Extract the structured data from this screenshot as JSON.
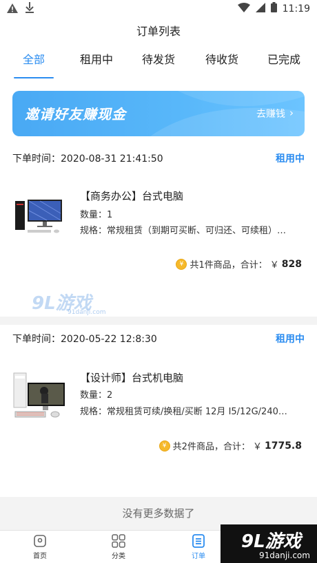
{
  "status_bar": {
    "time": "11:19",
    "left_icons": [
      "warning-icon",
      "download-icon"
    ],
    "right_icons": [
      "wifi-icon",
      "signal-icon",
      "battery-icon"
    ]
  },
  "header": {
    "title": "订单列表"
  },
  "tabs": [
    {
      "label": "全部",
      "active": true
    },
    {
      "label": "租用中",
      "active": false
    },
    {
      "label": "待发货",
      "active": false
    },
    {
      "label": "待收货",
      "active": false
    },
    {
      "label": "已完成",
      "active": false
    }
  ],
  "banner": {
    "title": "邀请好友赚现金",
    "action": "去赚钱",
    "chevron": "›"
  },
  "orders": [
    {
      "time_label": "下单时间：",
      "time": "2020-08-31 21:41:50",
      "status": "租用中",
      "product_name": "【商务办公】台式电脑",
      "qty": "数量：1",
      "spec": "规格：常规租赁（到期可买断、可归还、可续租）…",
      "count_text": "共1件商品，合计：",
      "currency": "￥",
      "amount": "828"
    },
    {
      "time_label": "下单时间：",
      "time": "2020-05-22 12:8:30",
      "status": "租用中",
      "product_name": "【设计师】台式机电脑",
      "qty": "数量：2",
      "spec": "规格：常规租赁可续/换租/买断 12月 I5/12G/240…",
      "count_text": "共2件商品，合计：",
      "currency": "￥",
      "amount": "1775.8"
    }
  ],
  "watermark": {
    "main": "9L游戏",
    "sub": "91danji.com"
  },
  "no_more_text": "没有更多数据了",
  "bottom_nav": [
    {
      "label": "首页",
      "icon": "home-icon",
      "active": false
    },
    {
      "label": "分类",
      "icon": "grid-icon",
      "active": false
    },
    {
      "label": "订单",
      "icon": "order-list-icon",
      "active": true
    }
  ],
  "corner_logo": {
    "main": "9L游戏",
    "sub": "91danji.com"
  },
  "colors": {
    "accent": "#2a8cf0",
    "coin": "#f6b92b",
    "divider": "#f3f3f3"
  }
}
